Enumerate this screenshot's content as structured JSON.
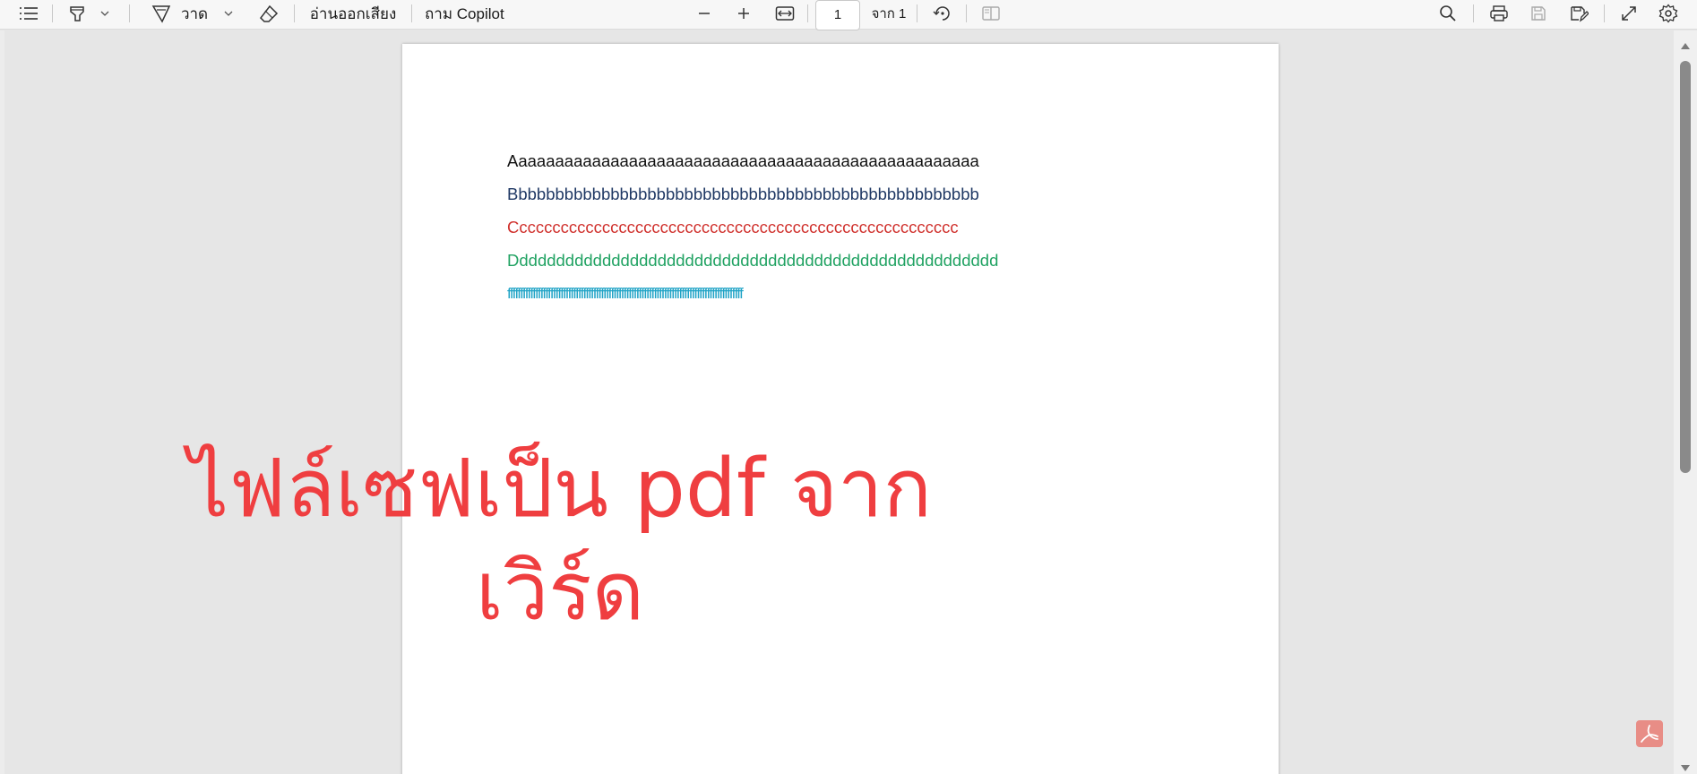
{
  "toolbar": {
    "icons": [
      "list-icon",
      "highlighter-icon",
      "chevron-down-icon",
      "draw-icon",
      "chevron-down-icon",
      "eraser-icon",
      "minus-icon",
      "plus-icon",
      "fit-width-icon",
      "rotate-icon",
      "two-page-icon",
      "search-icon",
      "print-icon",
      "save-icon",
      "save-as-icon",
      "fullscreen-icon",
      "settings-icon"
    ],
    "draw_label": "วาด",
    "read_aloud_label": "อ่านออกเสียง",
    "copilot_label": "ถาม Copilot",
    "page_number": "1",
    "page_total_label": "จาก 1"
  },
  "document": {
    "lines": [
      "Aaaaaaaaaaaaaaaaaaaaaaaaaaaaaaaaaaaaaaaaaaaaaaaaaaa",
      "Bbbbbbbbbbbbbbbbbbbbbbbbbbbbbbbbbbbbbbbbbbbbbbbbbbb",
      "Cccccccccccccccccccccccccccccccccccccccccccccccccccccc",
      "Ddddddddddddddddddddddddddddddddddddddddddddddddddddd",
      "fffffffffffffffffffffffffffffffffffffffffffffffffffffffffffffffffffffffffffffffffffffffffffff"
    ],
    "line_colors": [
      "#111111",
      "#1f3864",
      "#d0302c",
      "#20a262",
      "#1fa3c6"
    ]
  },
  "overlay": {
    "line1": "ไฟล์เซฟเป็น pdf จาก",
    "line2": "เวิร์ด",
    "color": "#ef3e40"
  },
  "badge_icon": "adobe-pdf-icon"
}
